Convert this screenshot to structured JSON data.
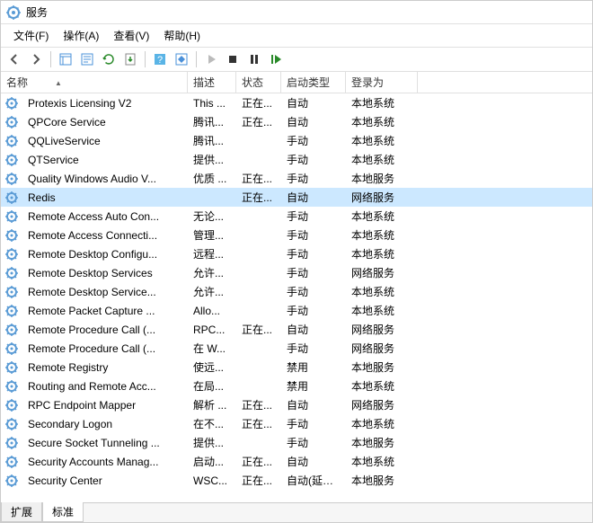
{
  "title": "服务",
  "menus": {
    "file": "文件(F)",
    "action": "操作(A)",
    "view": "查看(V)",
    "help": "帮助(H)"
  },
  "columns": {
    "name": "名称",
    "desc": "描述",
    "status": "状态",
    "startup": "启动类型",
    "logon": "登录为"
  },
  "tabs": {
    "extended": "扩展",
    "standard": "标准"
  },
  "services": [
    {
      "name": "Protexis Licensing V2",
      "desc": "This ...",
      "status": "正在...",
      "startup": "自动",
      "logon": "本地系统",
      "sel": false
    },
    {
      "name": "QPCore Service",
      "desc": "腾讯...",
      "status": "正在...",
      "startup": "自动",
      "logon": "本地系统",
      "sel": false
    },
    {
      "name": "QQLiveService",
      "desc": "腾讯...",
      "status": "",
      "startup": "手动",
      "logon": "本地系统",
      "sel": false
    },
    {
      "name": "QTService",
      "desc": "提供...",
      "status": "",
      "startup": "手动",
      "logon": "本地系统",
      "sel": false
    },
    {
      "name": "Quality Windows Audio V...",
      "desc": "优质 ...",
      "status": "正在...",
      "startup": "手动",
      "logon": "本地服务",
      "sel": false
    },
    {
      "name": "Redis",
      "desc": "",
      "status": "正在...",
      "startup": "自动",
      "logon": "网络服务",
      "sel": true
    },
    {
      "name": "Remote Access Auto Con...",
      "desc": "无论...",
      "status": "",
      "startup": "手动",
      "logon": "本地系统",
      "sel": false
    },
    {
      "name": "Remote Access Connecti...",
      "desc": "管理...",
      "status": "",
      "startup": "手动",
      "logon": "本地系统",
      "sel": false
    },
    {
      "name": "Remote Desktop Configu...",
      "desc": "远程...",
      "status": "",
      "startup": "手动",
      "logon": "本地系统",
      "sel": false
    },
    {
      "name": "Remote Desktop Services",
      "desc": "允许...",
      "status": "",
      "startup": "手动",
      "logon": "网络服务",
      "sel": false
    },
    {
      "name": "Remote Desktop Service...",
      "desc": "允许...",
      "status": "",
      "startup": "手动",
      "logon": "本地系统",
      "sel": false
    },
    {
      "name": "Remote Packet Capture ...",
      "desc": "Allo...",
      "status": "",
      "startup": "手动",
      "logon": "本地系统",
      "sel": false
    },
    {
      "name": "Remote Procedure Call (...",
      "desc": "RPC...",
      "status": "正在...",
      "startup": "自动",
      "logon": "网络服务",
      "sel": false
    },
    {
      "name": "Remote Procedure Call (...",
      "desc": "在 W...",
      "status": "",
      "startup": "手动",
      "logon": "网络服务",
      "sel": false
    },
    {
      "name": "Remote Registry",
      "desc": "使远...",
      "status": "",
      "startup": "禁用",
      "logon": "本地服务",
      "sel": false
    },
    {
      "name": "Routing and Remote Acc...",
      "desc": "在局...",
      "status": "",
      "startup": "禁用",
      "logon": "本地系统",
      "sel": false
    },
    {
      "name": "RPC Endpoint Mapper",
      "desc": "解析 ...",
      "status": "正在...",
      "startup": "自动",
      "logon": "网络服务",
      "sel": false
    },
    {
      "name": "Secondary Logon",
      "desc": "在不...",
      "status": "正在...",
      "startup": "手动",
      "logon": "本地系统",
      "sel": false
    },
    {
      "name": "Secure Socket Tunneling ...",
      "desc": "提供...",
      "status": "",
      "startup": "手动",
      "logon": "本地服务",
      "sel": false
    },
    {
      "name": "Security Accounts Manag...",
      "desc": "启动...",
      "status": "正在...",
      "startup": "自动",
      "logon": "本地系统",
      "sel": false
    },
    {
      "name": "Security Center",
      "desc": "WSC...",
      "status": "正在...",
      "startup": "自动(延迟...",
      "logon": "本地服务",
      "sel": false
    }
  ]
}
